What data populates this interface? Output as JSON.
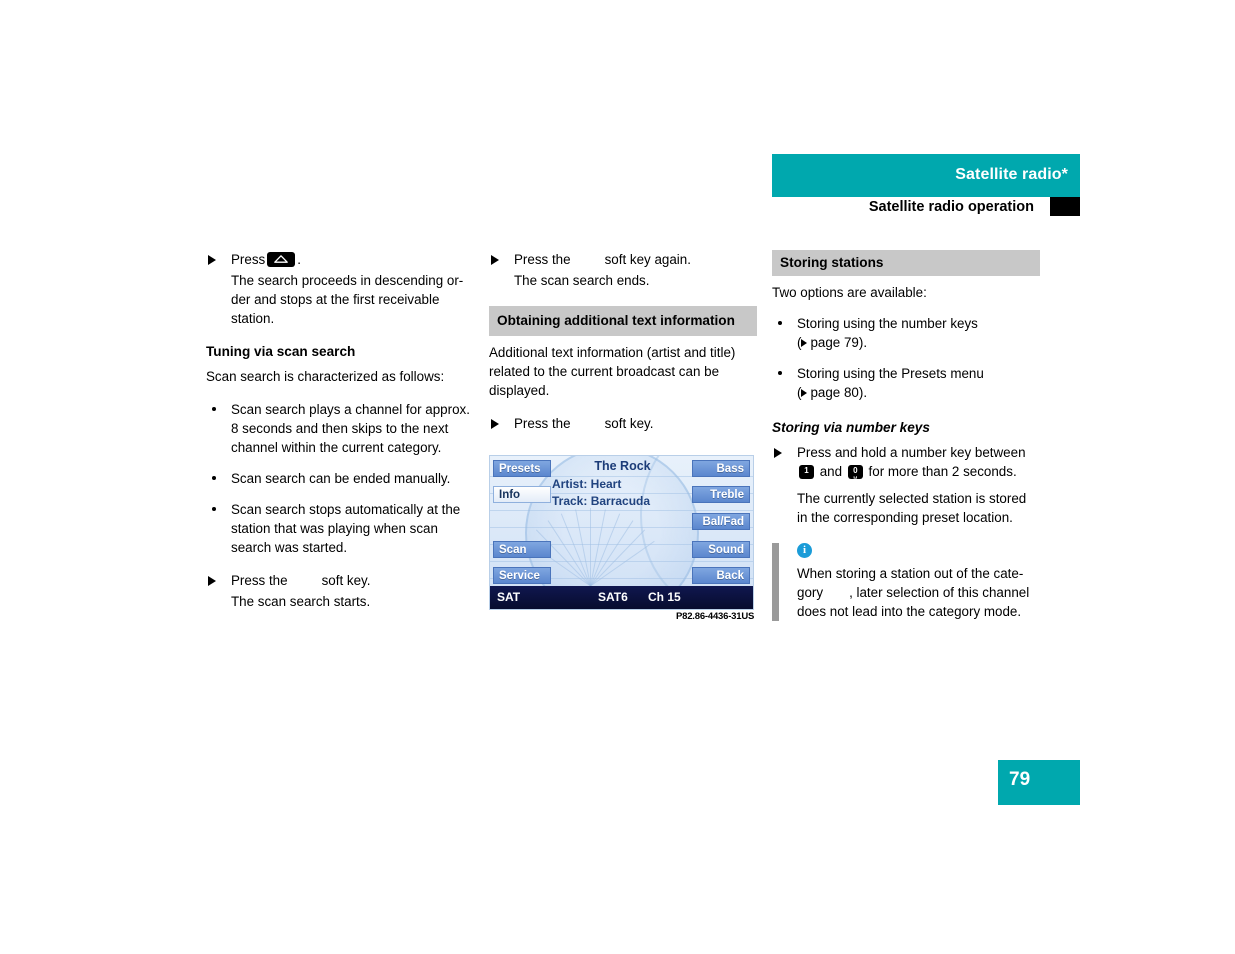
{
  "header": {
    "title": "Satellite radio*",
    "subtitle": "Satellite radio operation"
  },
  "page_number": "79",
  "figure_code": "P82.86-4436-31US",
  "left_column": {
    "step1": {
      "pre": "Press",
      "post": ".",
      "key_icon": "up-down-rocker-key"
    },
    "step1_body": "The search proceeds in descending or-der and stops at the first receivable station.",
    "heading": "Tuning via scan search",
    "intro": "Scan search is characterized as follows:",
    "bullets": [
      "Scan search plays a channel for approx. 8 seconds and then skips to the next channel within the current category.",
      "Scan search can be ended manually.",
      "Scan search stops automatically at the station that was playing when scan search was started."
    ],
    "step2_pre": "Press the",
    "step2_post": "soft key.",
    "step2_body": "The scan search starts."
  },
  "mid_column": {
    "step1_pre": "Press the",
    "step1_post": "soft key again.",
    "step1_body": "The scan search ends.",
    "gray_heading": "Obtaining additional text information",
    "paragraph": "Additional text information (artist and title) related to the current broadcast can be displayed.",
    "step2_pre": "Press the",
    "step2_post": "soft key."
  },
  "right_column": {
    "gray_heading": "Storing stations",
    "intro": "Two options are available:",
    "bullets": [
      {
        "text": "Storing using the number keys",
        "ref": "page 79",
        "ref_suffix": ")."
      },
      {
        "text": "Storing using the Presets menu",
        "ref": "page 80",
        "ref_suffix": ")."
      }
    ],
    "heading": "Storing via number keys",
    "step_pre": "Press and hold a number key between",
    "step_mid": "and",
    "step_post": "for more than 2 seconds.",
    "key_low": "1",
    "key_high": "0",
    "step_body": "The currently selected station is stored in the corresponding preset location.",
    "note": {
      "icon": "info-icon",
      "line1": "When storing a station out of the cate-",
      "line2_a": "gory",
      "line2_b": ", later selection of this channel",
      "line3": "does not lead into the category mode."
    }
  },
  "radio_display": {
    "left_buttons": [
      {
        "label": "Presets",
        "selected": false
      },
      {
        "label": "Info",
        "selected": true
      },
      {
        "label": "Scan",
        "selected": false
      },
      {
        "label": "Service",
        "selected": false
      }
    ],
    "right_buttons": [
      {
        "label": "Bass",
        "selected": false
      },
      {
        "label": "Treble",
        "selected": false
      },
      {
        "label": "Bal/Fad",
        "selected": false
      },
      {
        "label": "Sound",
        "selected": false
      },
      {
        "label": "Back",
        "selected": false
      }
    ],
    "station_title": "The Rock",
    "artist_line": "Artist: Heart",
    "track_line": "Track: Barracuda",
    "status_source": "SAT",
    "status_band": "SAT6",
    "status_channel": "Ch 15"
  },
  "colors": {
    "teal": "#00A8AE",
    "gray_band": "#c8c8c8",
    "note_bar": "#9a9a9a",
    "info_blue": "#1B9CD8",
    "radio_button_blue": "#5B87CE",
    "radio_status_navy": "#070c2e"
  }
}
